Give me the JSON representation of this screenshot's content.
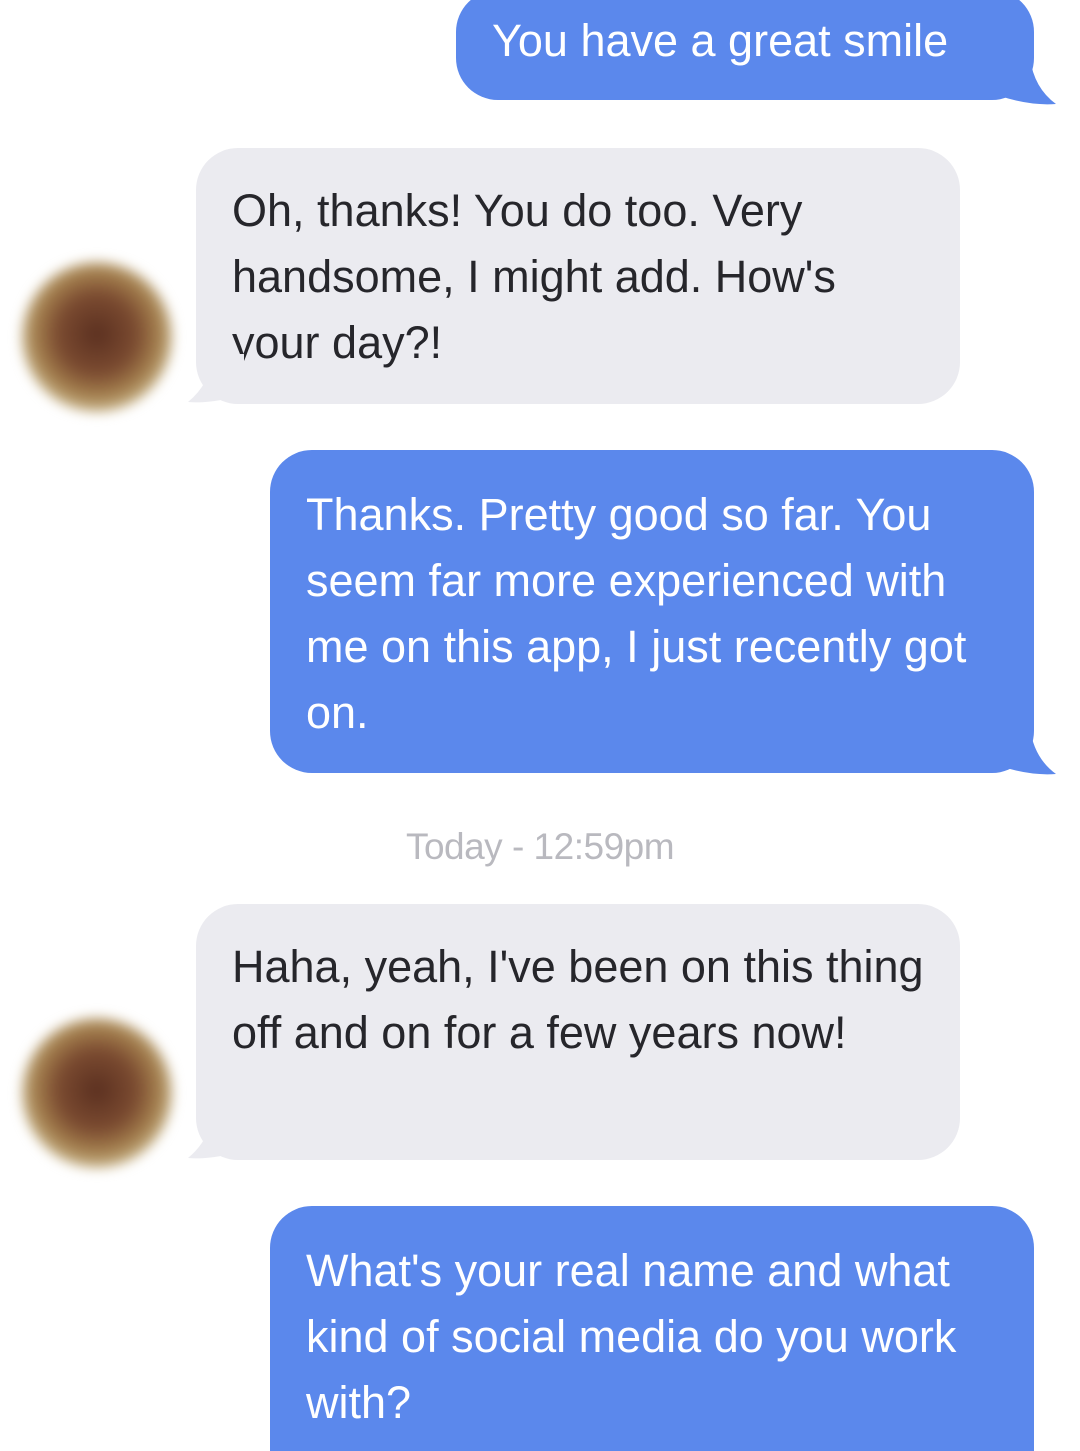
{
  "conversation": {
    "messages": [
      {
        "direction": "sent",
        "text": "You have a great smile"
      },
      {
        "direction": "received",
        "text": "Oh, thanks! You do too. Very handsome, I might add. How's your day?!"
      },
      {
        "direction": "sent",
        "text": "Thanks. Pretty good so far. You seem far more experienced with me on this app, I just recently got on."
      },
      {
        "direction": "received",
        "text": "Haha, yeah, I've been on this thing off and on for a few years now!"
      },
      {
        "direction": "sent",
        "text": "What's your real name and what kind of social media do you work with?"
      }
    ],
    "timestamp": "Today - 12:59pm"
  },
  "colors": {
    "sent_bubble": "#5b88ec",
    "received_bubble": "#ebebf0",
    "timestamp_text": "#b9b9bf"
  }
}
